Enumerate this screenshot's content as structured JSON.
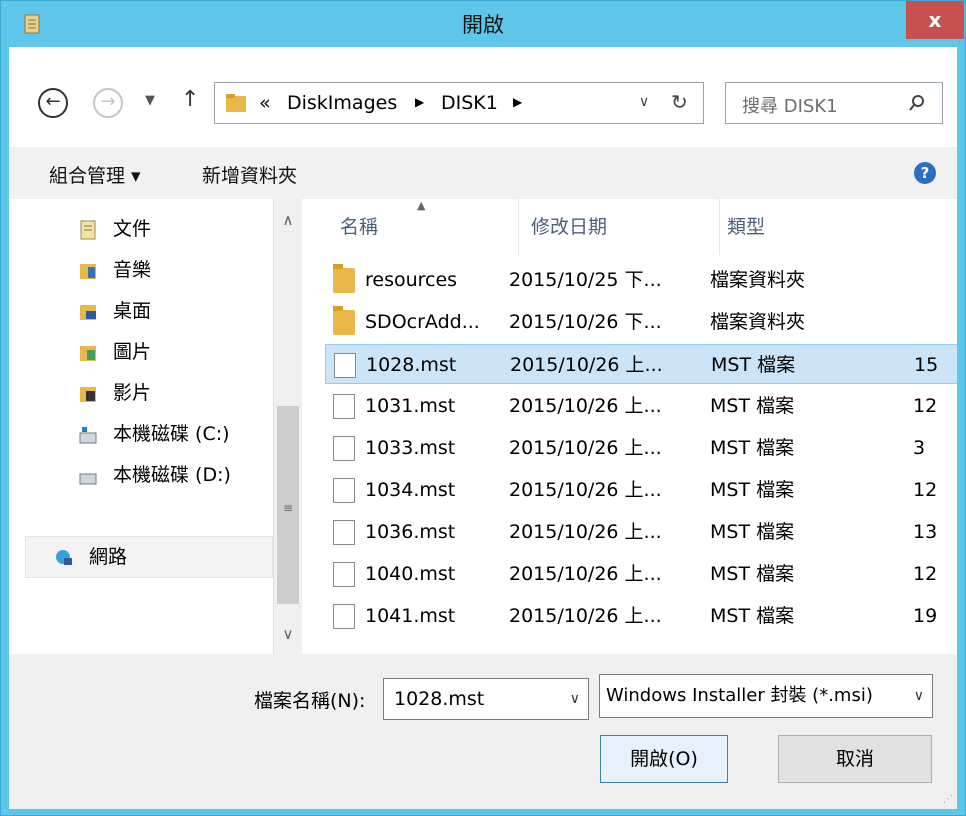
{
  "window": {
    "title": "開啟",
    "close_label": "x"
  },
  "nav": {
    "path": [
      "«",
      "DiskImages",
      "DISK1"
    ],
    "search_placeholder": "搜尋 DISK1"
  },
  "toolbar": {
    "organize_label": "組合管理 ▾",
    "new_folder_label": "新增資料夾"
  },
  "tree": [
    {
      "label": "文件",
      "icon": "documents-icon"
    },
    {
      "label": "音樂",
      "icon": "music-icon"
    },
    {
      "label": "桌面",
      "icon": "desktop-icon"
    },
    {
      "label": "圖片",
      "icon": "pictures-icon"
    },
    {
      "label": "影片",
      "icon": "videos-icon"
    },
    {
      "label": "本機磁碟 (C:)",
      "icon": "drive-icon"
    },
    {
      "label": "本機磁碟 (D:)",
      "icon": "drive-icon"
    },
    {
      "label": "網路",
      "icon": "network-icon"
    }
  ],
  "columns": {
    "name": "名稱",
    "date": "修改日期",
    "type": "類型"
  },
  "files": [
    {
      "name": "resources",
      "date": "2015/10/25 下...",
      "type": "檔案資料夾",
      "size": "",
      "kind": "folder"
    },
    {
      "name": "SDOcrAdd...",
      "date": "2015/10/26 下...",
      "type": "檔案資料夾",
      "size": "",
      "kind": "folder"
    },
    {
      "name": "1028.mst",
      "date": "2015/10/26 上...",
      "type": "MST 檔案",
      "size": "15",
      "kind": "file"
    },
    {
      "name": "1031.mst",
      "date": "2015/10/26 上...",
      "type": "MST 檔案",
      "size": "12",
      "kind": "file"
    },
    {
      "name": "1033.mst",
      "date": "2015/10/26 上...",
      "type": "MST 檔案",
      "size": "3",
      "kind": "file"
    },
    {
      "name": "1034.mst",
      "date": "2015/10/26 上...",
      "type": "MST 檔案",
      "size": "12",
      "kind": "file"
    },
    {
      "name": "1036.mst",
      "date": "2015/10/26 上...",
      "type": "MST 檔案",
      "size": "13",
      "kind": "file"
    },
    {
      "name": "1040.mst",
      "date": "2015/10/26 上...",
      "type": "MST 檔案",
      "size": "12",
      "kind": "file"
    },
    {
      "name": "1041.mst",
      "date": "2015/10/26 上...",
      "type": "MST 檔案",
      "size": "19",
      "kind": "file"
    }
  ],
  "bottom": {
    "filename_label": "檔案名稱(N):",
    "filename_value": "1028.mst",
    "filetype_value": "Windows Installer 封裝 (*.msi)",
    "open_label": "開啟(O)",
    "cancel_label": "取消"
  }
}
